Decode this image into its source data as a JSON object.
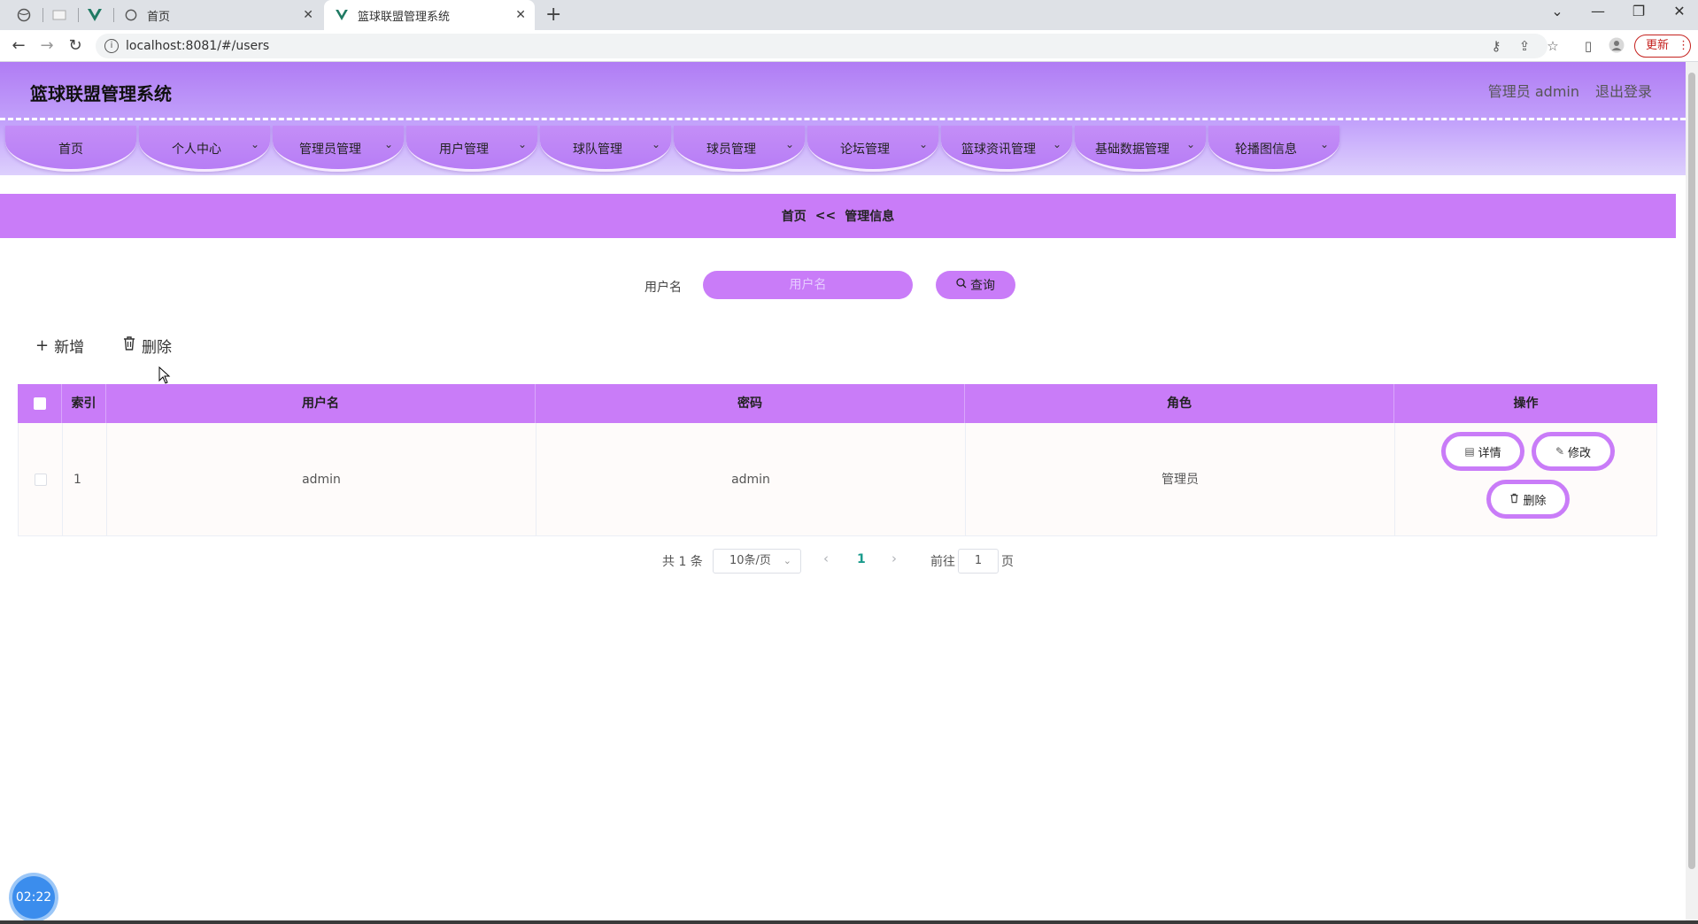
{
  "browser": {
    "tabs": [
      {
        "title": "首页",
        "active": false
      },
      {
        "title": "篮球联盟管理系统",
        "active": true
      }
    ],
    "url": "localhost:8081/#/users",
    "update_label": "更新"
  },
  "app": {
    "title": "篮球联盟管理系统",
    "user": "管理员 admin",
    "logout": "退出登录"
  },
  "menu": [
    {
      "label": "首页",
      "has_dropdown": false
    },
    {
      "label": "个人中心",
      "has_dropdown": true
    },
    {
      "label": "管理员管理",
      "has_dropdown": true
    },
    {
      "label": "用户管理",
      "has_dropdown": true
    },
    {
      "label": "球队管理",
      "has_dropdown": true
    },
    {
      "label": "球员管理",
      "has_dropdown": true
    },
    {
      "label": "论坛管理",
      "has_dropdown": true
    },
    {
      "label": "篮球资讯管理",
      "has_dropdown": true
    },
    {
      "label": "基础数据管理",
      "has_dropdown": true
    },
    {
      "label": "轮播图信息",
      "has_dropdown": true
    }
  ],
  "breadcrumb": {
    "home": "首页",
    "sep": "<<",
    "current": "管理信息"
  },
  "search": {
    "label": "用户名",
    "placeholder": "用户名",
    "button": "查询"
  },
  "actions": {
    "add": "新增",
    "delete": "删除"
  },
  "table": {
    "headers": [
      "索引",
      "用户名",
      "密码",
      "角色",
      "操作"
    ],
    "rows": [
      {
        "index": "1",
        "username": "admin",
        "password": "admin",
        "role": "管理员"
      }
    ],
    "row_actions": {
      "detail": "详情",
      "edit": "修改",
      "delete": "删除"
    }
  },
  "pagination": {
    "total_text": "共 1 条",
    "page_size": "10条/页",
    "current_page": "1",
    "goto_label": "前往",
    "goto_value": "1",
    "page_suffix": "页"
  },
  "clock": "02:22",
  "colors": {
    "accent": "#c97cf8",
    "header_top": "#b07cf4",
    "page_active": "#1a9b8c"
  }
}
